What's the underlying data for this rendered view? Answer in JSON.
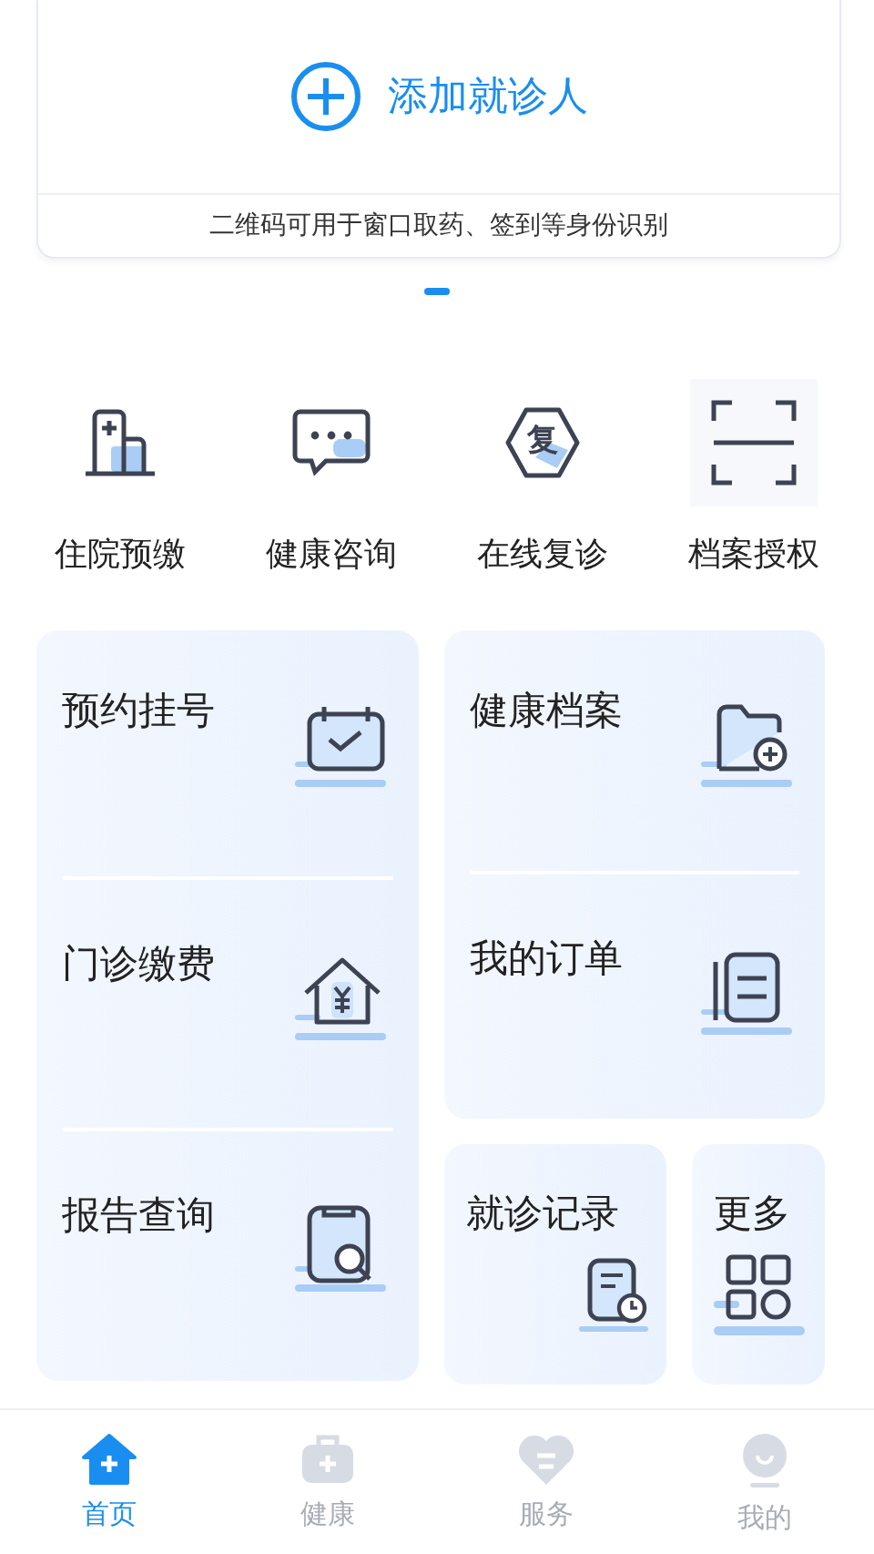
{
  "patient_card": {
    "add_label": "添加就诊人",
    "caption": "二维码可用于窗口取药、签到等身份识别"
  },
  "quick_actions": [
    {
      "label": "住院预缴"
    },
    {
      "label": "健康咨询"
    },
    {
      "label": "在线复诊",
      "icon_text": "复"
    },
    {
      "label": "档案授权"
    }
  ],
  "services": {
    "left": [
      {
        "label": "预约挂号"
      },
      {
        "label": "门诊缴费"
      },
      {
        "label": "报告查询"
      }
    ],
    "right": [
      {
        "label": "健康档案"
      },
      {
        "label": "我的订单"
      }
    ],
    "small": [
      {
        "label": "就诊记录"
      },
      {
        "label": "更多"
      }
    ]
  },
  "tab_bar": [
    {
      "label": "首页",
      "selected": true
    },
    {
      "label": "健康",
      "selected": false
    },
    {
      "label": "服务",
      "selected": false
    },
    {
      "label": "我的",
      "selected": false
    }
  ]
}
